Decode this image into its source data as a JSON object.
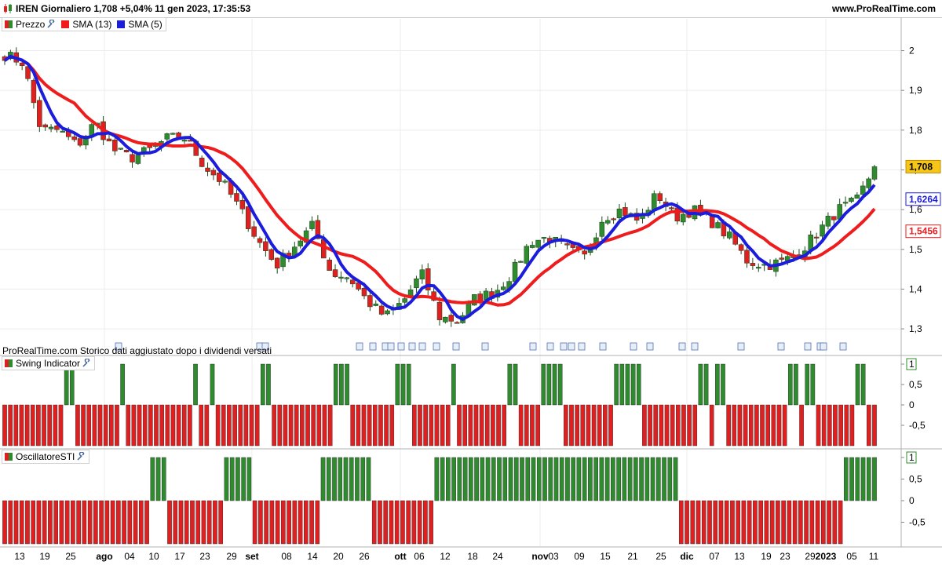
{
  "header": {
    "title": "IREN Giornaliero 1,708 +5,04% 11 gen 2023, 17:35:53",
    "brand": "www.ProRealTime.com"
  },
  "legend": {
    "price": "Prezzo",
    "sma13": "SMA (13)",
    "sma5": "SMA (5)",
    "swing": "Swing Indicator",
    "oscillator": "OscillatoreSTI"
  },
  "note": "ProRealTime.com Storico dati aggiustato dopo i dividendi versati",
  "colors": {
    "up": "#2e8b2e",
    "down": "#e02020",
    "sma13": "#ee1c1c",
    "sma5": "#1c1cdc",
    "last_price_bg": "#f5c518"
  },
  "chart_data": [
    {
      "type": "candlestick",
      "title": "IREN Giornaliero",
      "ylim": [
        1.235,
        2.08
      ],
      "y_ticks": [
        "2",
        "1,9",
        "1,8",
        "1,7",
        "1,6",
        "1,5",
        "1,4",
        "1,3"
      ],
      "x_labels": [
        "13",
        "19",
        "25",
        "ago",
        "04",
        "10",
        "17",
        "23",
        "29",
        "set",
        "08",
        "14",
        "20",
        "26",
        "ott",
        "06",
        "12",
        "18",
        "24",
        "nov",
        "03",
        "09",
        "15",
        "21",
        "25",
        "dic",
        "07",
        "13",
        "19",
        "23",
        "29",
        "2023",
        "05",
        "11"
      ],
      "last_price": "1,708",
      "sma5_last": "1,6264",
      "sma13_last": "1,5456",
      "price_anchors": [
        1.99,
        1.97,
        1.8,
        1.8,
        1.76,
        1.82,
        1.75,
        1.73,
        1.75,
        1.78,
        1.78,
        1.71,
        1.67,
        1.6,
        1.52,
        1.46,
        1.51,
        1.56,
        1.44,
        1.43,
        1.37,
        1.33,
        1.37,
        1.44,
        1.33,
        1.32,
        1.38,
        1.39,
        1.44,
        1.52,
        1.53,
        1.5,
        1.48,
        1.58,
        1.6,
        1.57,
        1.64,
        1.58,
        1.6,
        1.57,
        1.53,
        1.47,
        1.46,
        1.47,
        1.5,
        1.55,
        1.6,
        1.62,
        1.708
      ]
    },
    {
      "type": "bar",
      "title": "Swing Indicator",
      "ylim": [
        -1.1,
        1.1
      ],
      "y_ticks": [
        "1",
        "0,5",
        "0",
        "-0,5"
      ],
      "up_value": 1,
      "down_value": -1,
      "pattern": "ddddddddddduuddddddddudddddddddddduddudddddddduuddddddddddduuudddddddduuuddddddduddddddddduudddduuuuddddddddduuuuudddddddddduuduuddddddddddduuduuddddddduudd"
    },
    {
      "type": "bar",
      "title": "OscillatoreSTI",
      "ylim": [
        -1.1,
        1.1
      ],
      "y_ticks": [
        "1",
        "0,5",
        "0",
        "-0,5"
      ],
      "up_value": 1,
      "down_value": -1,
      "pattern": "dddddddddddddddddddddddddduuudddddddddduuuuudddddddddddduuuuuuuuuddddddddddduuuuuuuuuuuuuuuuuuuuuuuuuuuuuuuuuuuuuuuuuuuddddddddddddddddddddddddddddduuuuuu"
    }
  ]
}
